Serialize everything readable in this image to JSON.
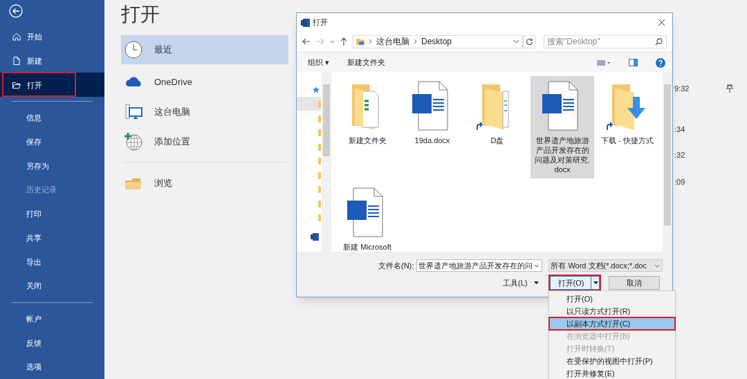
{
  "sidebar": {
    "items": [
      {
        "label": "开始",
        "selected": false,
        "disabled": false,
        "red_outline": false
      },
      {
        "label": "新建",
        "selected": false,
        "disabled": false,
        "red_outline": false
      },
      {
        "label": "打开",
        "selected": true,
        "disabled": false,
        "red_outline": true
      },
      {
        "label": "信息",
        "selected": false,
        "disabled": false,
        "red_outline": false
      },
      {
        "label": "保存",
        "selected": false,
        "disabled": false,
        "red_outline": false
      },
      {
        "label": "另存为",
        "selected": false,
        "disabled": false,
        "red_outline": false
      },
      {
        "label": "历史记录",
        "selected": false,
        "disabled": true,
        "red_outline": false
      },
      {
        "label": "打印",
        "selected": false,
        "disabled": false,
        "red_outline": false
      },
      {
        "label": "共享",
        "selected": false,
        "disabled": false,
        "red_outline": false
      },
      {
        "label": "导出",
        "selected": false,
        "disabled": false,
        "red_outline": false
      },
      {
        "label": "关闭",
        "selected": false,
        "disabled": false,
        "red_outline": false
      },
      {
        "label": "帐户",
        "selected": false,
        "disabled": false,
        "red_outline": false
      },
      {
        "label": "反馈",
        "selected": false,
        "disabled": false,
        "red_outline": false
      },
      {
        "label": "选项",
        "selected": false,
        "disabled": false,
        "red_outline": false
      }
    ]
  },
  "page_title": "打开",
  "places": [
    {
      "label": "最近",
      "kind": "clock",
      "selected": true
    },
    {
      "label": "OneDrive",
      "kind": "cloud",
      "selected": false
    },
    {
      "label": "这台电脑",
      "kind": "computer",
      "selected": false
    },
    {
      "label": "添加位置",
      "kind": "globe",
      "selected": false
    },
    {
      "label": "浏览",
      "kind": "folder",
      "selected": false
    }
  ],
  "recent_times": [
    {
      "time": "9:32",
      "pinned": true
    },
    {
      "time": ":34",
      "pinned": false
    },
    {
      "time": ":32",
      "pinned": false
    },
    {
      "time": ":09",
      "pinned": false
    }
  ],
  "dialog": {
    "title": "打开",
    "breadcrumb": [
      "这台电脑",
      "Desktop"
    ],
    "search": {
      "placeholder": "搜索\"Desktop\""
    },
    "toolbar": [
      "组织 ▾",
      "新建文件夹"
    ],
    "files": [
      {
        "name": "新建文件夹",
        "kind": "folder-docs",
        "selected": false
      },
      {
        "name": "19da.docx",
        "kind": "word",
        "selected": false
      },
      {
        "name": "D盘",
        "kind": "folder-shortcut",
        "selected": false
      },
      {
        "name": "世界遗产地旅游产品开发存在的问题及对策研究.docx",
        "kind": "word",
        "selected": true
      },
      {
        "name": "下载 - 快捷方式",
        "kind": "download-shortcut",
        "selected": false
      },
      {
        "name": "新建 Microsoft",
        "kind": "word",
        "selected": false
      }
    ],
    "filename_label": "文件名(N):",
    "filename": "世界遗产地旅游产品开发存在的问",
    "filter": "所有 Word 文档(*.docx;*.doc",
    "tools": "工具(L)",
    "open_button": {
      "label": "打开(O)",
      "red_outline": true
    },
    "cancel_button": "取消",
    "open_menu": [
      {
        "label": "打开(O)",
        "selected": false,
        "disabled": false,
        "red_outline": false
      },
      {
        "label": "以只读方式打开(R)",
        "selected": false,
        "disabled": false,
        "red_outline": false
      },
      {
        "label": "以副本方式打开(C)",
        "selected": true,
        "disabled": false,
        "red_outline": true
      },
      {
        "label": "在浏览器中打开(B)",
        "selected": false,
        "disabled": true,
        "red_outline": false
      },
      {
        "label": "打开时转换(T)",
        "selected": false,
        "disabled": true,
        "red_outline": false
      },
      {
        "label": "在受保护的视图中打开(P)",
        "selected": false,
        "disabled": false,
        "red_outline": false
      },
      {
        "label": "打开并修复(E)",
        "selected": false,
        "disabled": false,
        "red_outline": false
      }
    ]
  }
}
